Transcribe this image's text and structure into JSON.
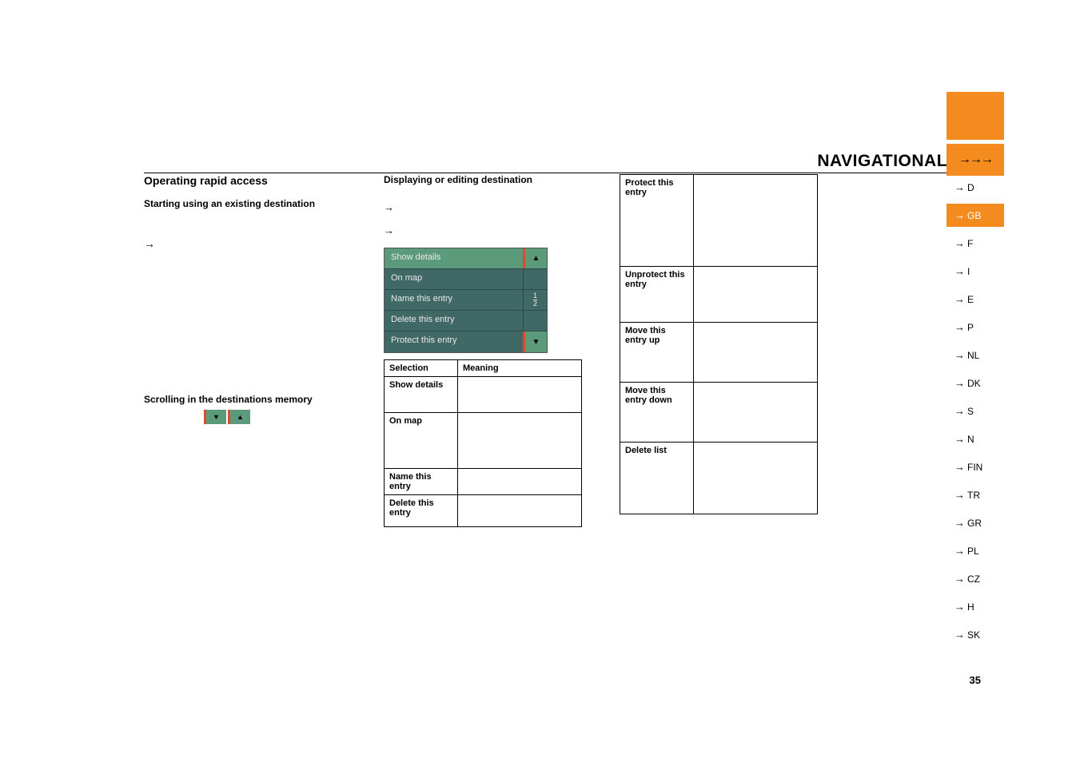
{
  "header": {
    "title": "NAVIGATIONAL MODE",
    "arrows": "→→→"
  },
  "col1": {
    "heading": "Operating rapid access",
    "sub1": "Starting using an existing destination",
    "bullet1": "→",
    "sub2": "Scrolling in the destinations memory",
    "scroll_down": "▼",
    "scroll_up": "▲"
  },
  "col2": {
    "heading": "Displaying or editing destination",
    "bullet1": "→",
    "bullet2": "→",
    "editbox": {
      "r1": "Show details",
      "r2": "On map",
      "r3": "Name this entry",
      "r4": "Delete this entry",
      "r5": "Protect this entry",
      "btn_up": "▲",
      "btn_down": "▼"
    },
    "table": {
      "h1": "Selection",
      "h2": "Meaning",
      "r1c1": "Show details",
      "r1c2": "",
      "r2c1": "On map",
      "r2c2": "",
      "r3c1": "Name this entry",
      "r3c2": "",
      "r4c1": "Delete this entry",
      "r4c2": ""
    }
  },
  "col3": {
    "table": {
      "r1c1": "Protect this entry",
      "r1c2": "",
      "r2c1": "Unprotect this entry",
      "r2c2": "",
      "r3c1": "Move this entry up",
      "r3c2": "",
      "r4c1": "Move this entry down",
      "r4c2": "",
      "r5c1": "Delete list",
      "r5c2": ""
    }
  },
  "sidebar": {
    "langs": [
      {
        "code": "D",
        "active": false
      },
      {
        "code": "GB",
        "active": true
      },
      {
        "code": "F",
        "active": false
      },
      {
        "code": "I",
        "active": false
      },
      {
        "code": "E",
        "active": false
      },
      {
        "code": "P",
        "active": false
      },
      {
        "code": "NL",
        "active": false
      },
      {
        "code": "DK",
        "active": false
      },
      {
        "code": "S",
        "active": false
      },
      {
        "code": "N",
        "active": false
      },
      {
        "code": "FIN",
        "active": false
      },
      {
        "code": "TR",
        "active": false
      },
      {
        "code": "GR",
        "active": false
      },
      {
        "code": "PL",
        "active": false
      },
      {
        "code": "CZ",
        "active": false
      },
      {
        "code": "H",
        "active": false
      },
      {
        "code": "SK",
        "active": false
      }
    ]
  },
  "page_number": "35"
}
